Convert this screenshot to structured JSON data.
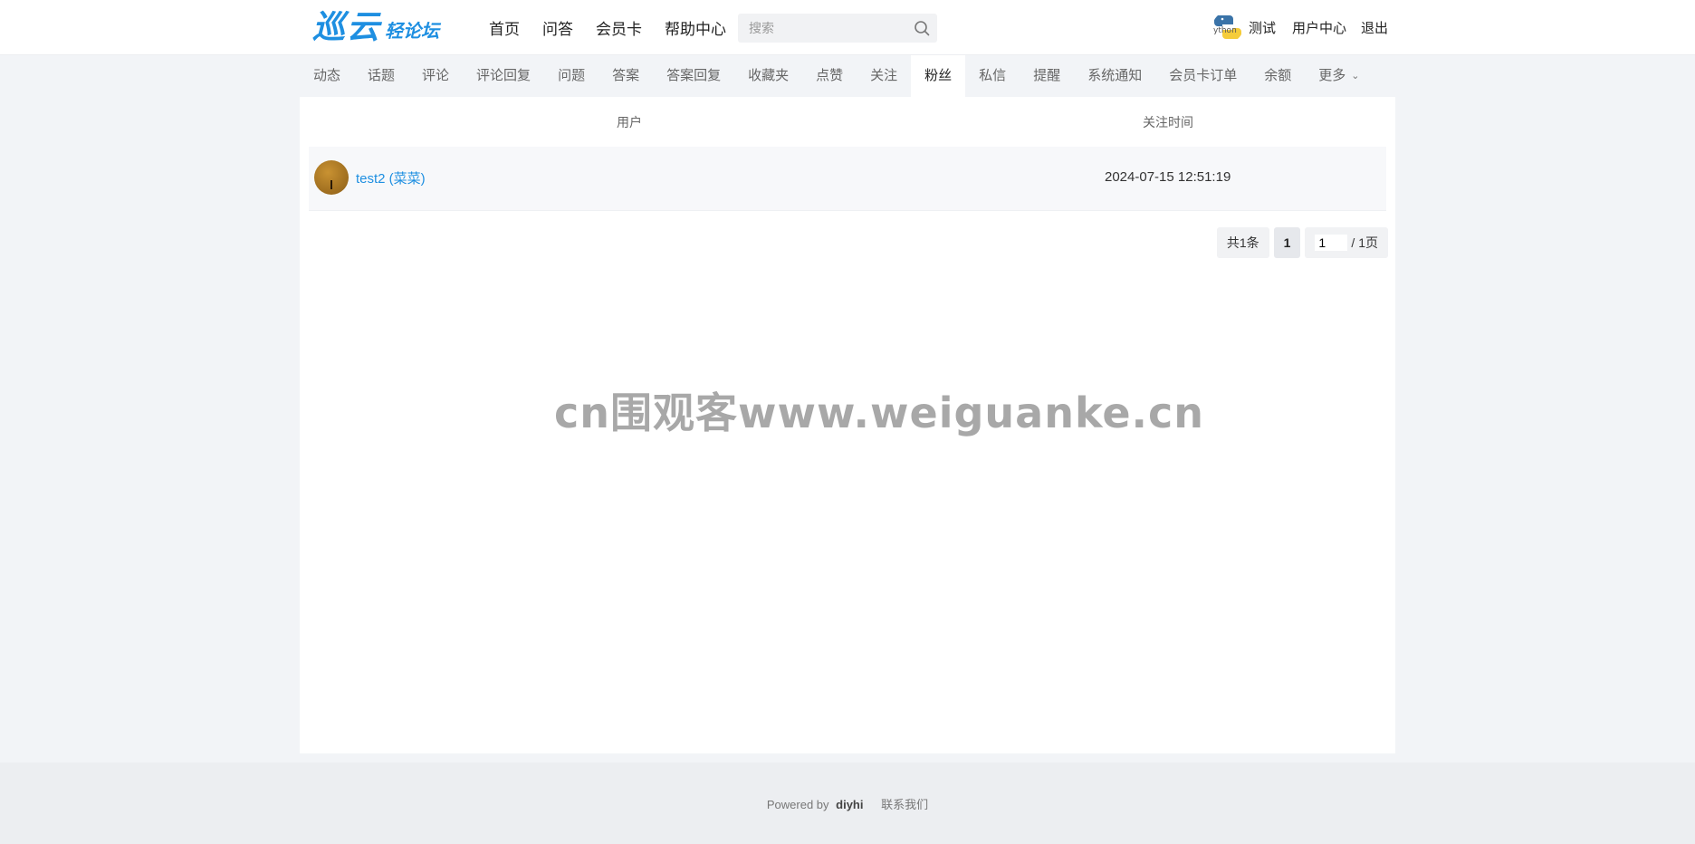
{
  "header": {
    "logo_main": "巡云",
    "logo_sub": "轻论坛",
    "nav": [
      "首页",
      "问答",
      "会员卡",
      "帮助中心"
    ],
    "search_placeholder": "搜索",
    "avatar_text": "ython",
    "username": "测试",
    "user_center": "用户中心",
    "logout": "退出"
  },
  "tabs": {
    "items": [
      "动态",
      "话题",
      "评论",
      "评论回复",
      "问题",
      "答案",
      "答案回复",
      "收藏夹",
      "点赞",
      "关注",
      "粉丝",
      "私信",
      "提醒",
      "系统通知",
      "会员卡订单",
      "余额",
      "更多"
    ],
    "active": "粉丝"
  },
  "table": {
    "columns": [
      "用户",
      "关注时间"
    ],
    "rows": [
      {
        "user": "test2 (菜菜)",
        "time": "2024-07-15 12:51:19"
      }
    ]
  },
  "pager": {
    "total": "共1条",
    "current": "1",
    "input_value": "1",
    "pages": "/ 1页"
  },
  "watermark": "cn围观客www.weiguanke.cn",
  "footer": {
    "powered_by": "Powered by",
    "brand": "diyhi",
    "contact": "联系我们"
  },
  "colors": {
    "accent": "#1e8fe1",
    "background": "#f2f4f7"
  }
}
